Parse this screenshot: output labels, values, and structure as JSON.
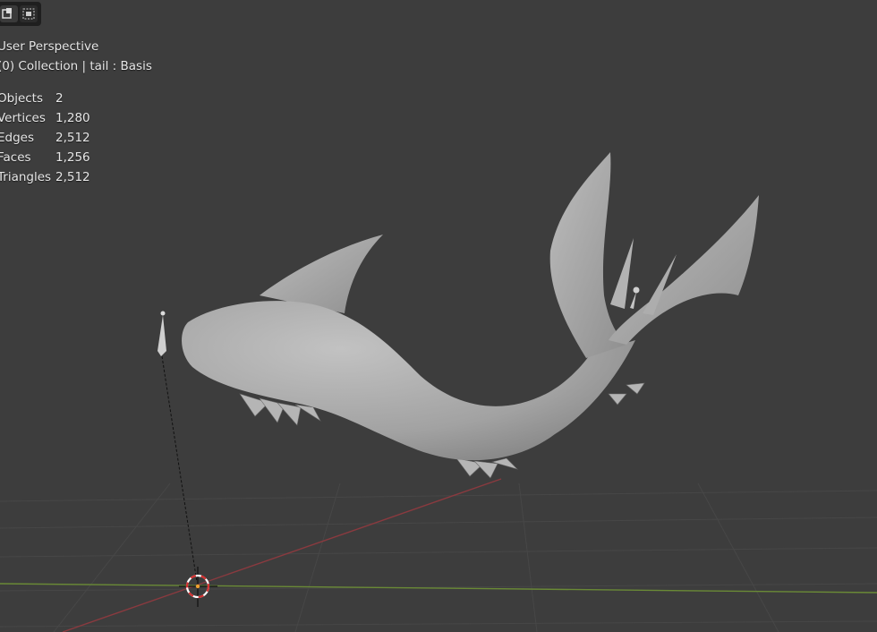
{
  "viewport": {
    "view_name": "User Perspective",
    "collection_line": "(0) Collection | tail : Basis",
    "stats": [
      {
        "label": "Objects",
        "value": "2"
      },
      {
        "label": "Vertices",
        "value": "1,280"
      },
      {
        "label": "Edges",
        "value": "2,512"
      },
      {
        "label": "Faces",
        "value": "1,256"
      },
      {
        "label": "Triangles",
        "value": "2,512"
      }
    ]
  },
  "toolbar": {
    "icons": [
      "select-box-icon",
      "select-mode-icon"
    ]
  },
  "colors": {
    "background": "#3d3d3d",
    "x_axis": "#8a3a3f",
    "y_axis": "#6a8a36",
    "mesh": "#a6a6a6",
    "cursor_red": "#d33030"
  }
}
